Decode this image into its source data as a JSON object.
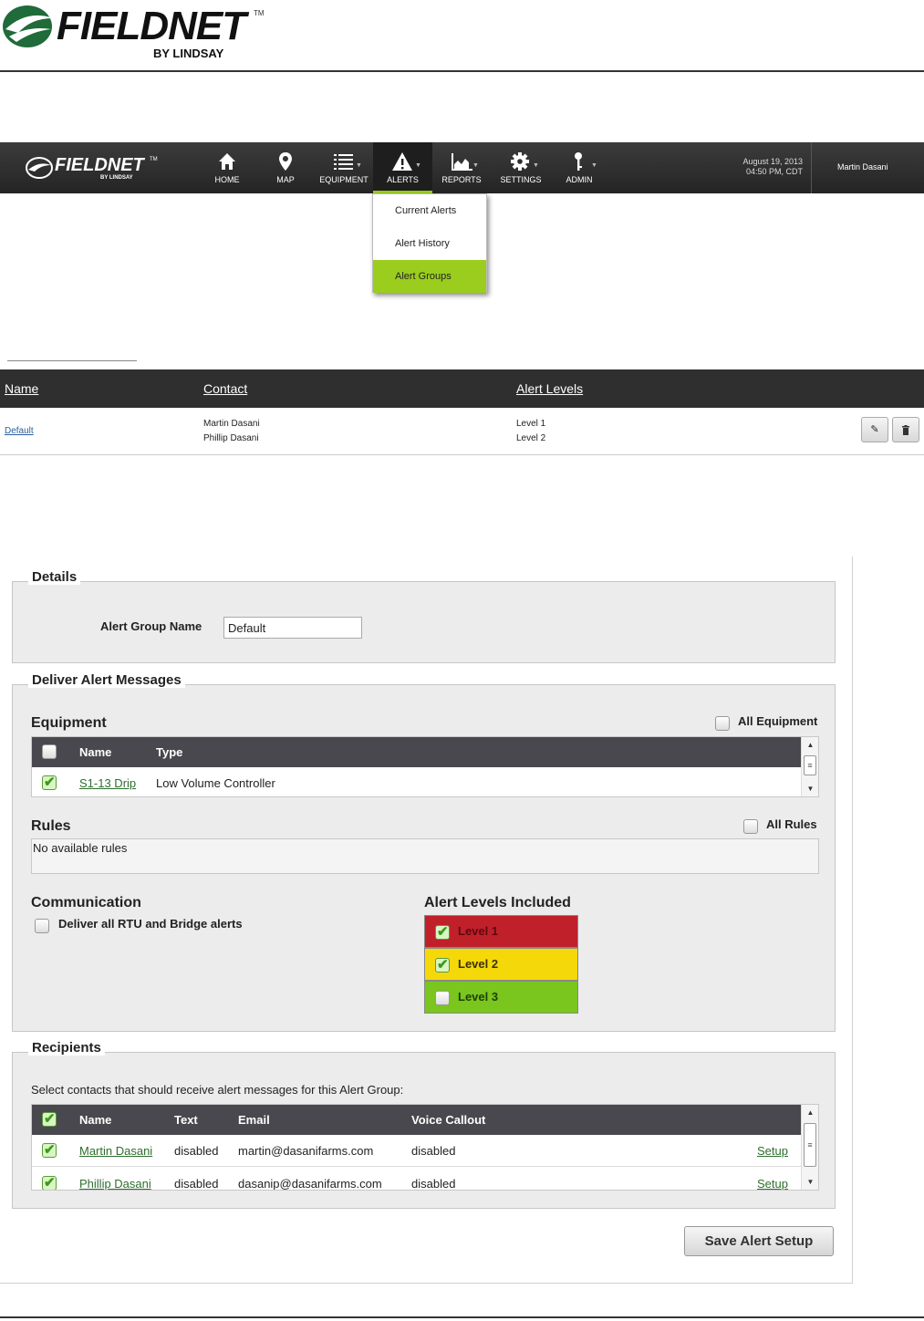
{
  "doc_header": {
    "logo_word": "FIELDNET",
    "logo_tm": "TM",
    "logo_sub": "BY LINDSAY"
  },
  "navbar": {
    "logo_word": "FIELDNET",
    "logo_tm": "TM",
    "logo_sub": "BY LINDSAY",
    "items": [
      {
        "label": "HOME",
        "icon": "home-icon"
      },
      {
        "label": "MAP",
        "icon": "map-pin-icon"
      },
      {
        "label": "EQUIPMENT",
        "icon": "list-icon"
      },
      {
        "label": "ALERTS",
        "icon": "warning-icon"
      },
      {
        "label": "REPORTS",
        "icon": "chart-icon"
      },
      {
        "label": "SETTINGS",
        "icon": "gear-icon"
      },
      {
        "label": "ADMIN",
        "icon": "key-icon"
      }
    ],
    "active": "ALERTS",
    "date": "August 19, 2013",
    "time": "04:50 PM, CDT",
    "user": "Martin Dasani"
  },
  "alerts_menu": {
    "items": [
      "Current Alerts",
      "Alert History",
      "Alert Groups"
    ],
    "selected": "Alert Groups"
  },
  "groups_list": {
    "headers": {
      "name": "Name",
      "contact": "Contact",
      "levels": "Alert Levels"
    },
    "rows": [
      {
        "name": "Default",
        "contacts": [
          "Martin Dasani",
          "Phillip Dasani"
        ],
        "levels": [
          "Level 1",
          "Level 2"
        ]
      }
    ]
  },
  "details": {
    "legend": "Details",
    "group_name_label": "Alert Group Name",
    "group_name_value": "Default"
  },
  "deliver": {
    "legend": "Deliver Alert Messages",
    "equipment": {
      "title": "Equipment",
      "all_label": "All Equipment",
      "all_checked": false,
      "headers": {
        "name": "Name",
        "type": "Type"
      },
      "rows": [
        {
          "checked": true,
          "name": "S1-13 Drip",
          "type": "Low Volume Controller"
        }
      ]
    },
    "rules": {
      "title": "Rules",
      "all_label": "All Rules",
      "all_checked": false,
      "empty_text": "No available rules"
    },
    "communication": {
      "title": "Communication",
      "option_label": "Deliver all RTU and Bridge alerts",
      "option_checked": false
    },
    "levels": {
      "title": "Alert Levels Included",
      "items": [
        {
          "label": "Level 1",
          "checked": true,
          "color": "#c0202a"
        },
        {
          "label": "Level 2",
          "checked": true,
          "color": "#f5d80a"
        },
        {
          "label": "Level 3",
          "checked": false,
          "color": "#7ac51e"
        }
      ]
    }
  },
  "recipients": {
    "legend": "Recipients",
    "instruction": "Select contacts that should receive alert messages for this Alert Group:",
    "headers": {
      "name": "Name",
      "text": "Text",
      "email": "Email",
      "voice": "Voice Callout"
    },
    "all_checked": true,
    "rows": [
      {
        "checked": true,
        "name": "Martin Dasani",
        "text": "disabled",
        "email": "martin@dasanifarms.com",
        "voice": "disabled",
        "action": "Setup"
      },
      {
        "checked": true,
        "name": "Phillip Dasani",
        "text": "disabled",
        "email": "dasanip@dasanifarms.com",
        "voice": "disabled",
        "action": "Setup"
      }
    ]
  },
  "save_label": "Save Alert Setup",
  "colors": {
    "accent": "#9acd1e",
    "navbar": "#2f2f2f",
    "table_header": "#48484e"
  }
}
